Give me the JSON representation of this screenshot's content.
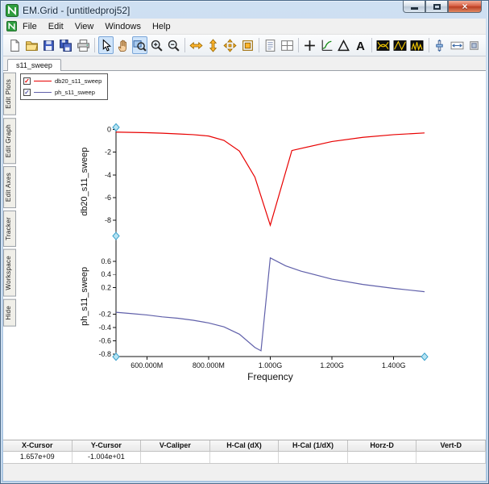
{
  "window": {
    "title": "EM.Grid - [untitledproj52]"
  },
  "menubar": {
    "items": [
      "File",
      "Edit",
      "View",
      "Windows",
      "Help"
    ]
  },
  "toolbar": {
    "groups": [
      [
        {
          "name": "new-file-button",
          "icon": "doc-new"
        },
        {
          "name": "open-button",
          "icon": "folder-open"
        },
        {
          "name": "save-button",
          "icon": "floppy"
        },
        {
          "name": "save-all-button",
          "icon": "floppy-multi"
        },
        {
          "name": "print-button",
          "icon": "printer"
        }
      ],
      [
        {
          "name": "pointer-tool-button",
          "icon": "cursor-arrow",
          "active": true
        },
        {
          "name": "pan-tool-button",
          "icon": "hand-pan"
        },
        {
          "name": "zoom-window-button",
          "icon": "zoom-window",
          "active": true
        },
        {
          "name": "zoom-in-button",
          "icon": "magnifier-plus"
        },
        {
          "name": "zoom-out-button",
          "icon": "magnifier-minus"
        }
      ],
      [
        {
          "name": "fit-horizontal-button",
          "icon": "arrows-horizontal-orange"
        },
        {
          "name": "fit-vertical-button",
          "icon": "arrows-vertical-orange"
        },
        {
          "name": "fit-all-button",
          "icon": "arrows-all-orange"
        },
        {
          "name": "zoom-extents-button",
          "icon": "box-orange"
        }
      ],
      [
        {
          "name": "single-plot-layout-button",
          "icon": "page-lines"
        },
        {
          "name": "grid-plot-layout-button",
          "icon": "page-grid"
        }
      ],
      [
        {
          "name": "add-marker-button",
          "icon": "plus-cross"
        },
        {
          "name": "show-axes-button",
          "icon": "axes-curve"
        },
        {
          "name": "caliper-button",
          "icon": "delta-triangle"
        },
        {
          "name": "add-text-button",
          "icon": "letter-a"
        }
      ],
      [
        {
          "name": "eye-diagram-button",
          "icon": "eye-diagram"
        },
        {
          "name": "cross-trace-button",
          "icon": "eye-cross"
        },
        {
          "name": "spectrum-button",
          "icon": "eye-spectrum"
        }
      ],
      [
        {
          "name": "vertical-scale-button",
          "icon": "slider-vertical"
        },
        {
          "name": "horizontal-span-button",
          "icon": "arrows-box"
        },
        {
          "name": "options-button",
          "icon": "small-box"
        }
      ]
    ]
  },
  "tabs": [
    {
      "label": "s11_sweep",
      "active": true
    }
  ],
  "sidebar": {
    "tabs": [
      "Edit Plots",
      "Edit Graph",
      "Edit Axes",
      "Tracker",
      "Workspace",
      "Hide"
    ]
  },
  "legend": {
    "items": [
      {
        "label": "db20_s11_sweep",
        "color": "#e80000",
        "checked": true
      },
      {
        "label": "ph_s11_sweep",
        "color": "#6060aa",
        "checked": true
      }
    ]
  },
  "colors": {
    "trace_red": "#e80000",
    "trace_blue": "#6060aa",
    "handle_fill": "#b8e4f2",
    "handle_stroke": "#38a0cc"
  },
  "chart_data": [
    {
      "type": "line",
      "ylabel": "db20_s11_sweep",
      "ylim": [
        -9.4,
        0.2
      ],
      "yticks": [
        {
          "v": 0,
          "l": "0"
        },
        {
          "v": -2,
          "l": "-2"
        },
        {
          "v": -4,
          "l": "-4"
        },
        {
          "v": -6,
          "l": "-6"
        },
        {
          "v": -8,
          "l": "-8"
        }
      ],
      "xlim": [
        500000000.0,
        1500000000.0
      ],
      "series": [
        {
          "name": "db20_s11_sweep",
          "color": "#e80000",
          "x": [
            500000000.0,
            550000000.0,
            600000000.0,
            650000000.0,
            700000000.0,
            750000000.0,
            800000000.0,
            850000000.0,
            900000000.0,
            950000000.0,
            1000000000.0,
            1070000000.0,
            1200000000.0,
            1300000000.0,
            1400000000.0,
            1500000000.0
          ],
          "y": [
            -0.22,
            -0.25,
            -0.28,
            -0.32,
            -0.38,
            -0.45,
            -0.57,
            -0.95,
            -1.9,
            -4.2,
            -8.45,
            -1.85,
            -1.05,
            -0.68,
            -0.45,
            -0.3
          ]
        }
      ]
    },
    {
      "type": "line",
      "ylabel": "ph_s11_sweep",
      "xlabel": "Frequency",
      "ylim": [
        -0.84,
        0.98
      ],
      "yticks": [
        {
          "v": 0.6,
          "l": "0.6"
        },
        {
          "v": 0.4,
          "l": "0.4"
        },
        {
          "v": 0.2,
          "l": "0.2"
        },
        {
          "v": -0.2,
          "l": "-0.2"
        },
        {
          "v": -0.4,
          "l": "-0.4"
        },
        {
          "v": -0.6,
          "l": "-0.6"
        },
        {
          "v": -0.8,
          "l": "-0.8"
        }
      ],
      "xlim": [
        500000000.0,
        1500000000.0
      ],
      "xticks": [
        {
          "v": 600000000.0,
          "l": "600.000M"
        },
        {
          "v": 800000000.0,
          "l": "800.000M"
        },
        {
          "v": 1000000000.0,
          "l": "1.000G"
        },
        {
          "v": 1200000000.0,
          "l": "1.200G"
        },
        {
          "v": 1400000000.0,
          "l": "1.400G"
        }
      ],
      "series": [
        {
          "name": "ph_s11_sweep",
          "color": "#6060aa",
          "x": [
            500000000.0,
            550000000.0,
            600000000.0,
            650000000.0,
            700000000.0,
            750000000.0,
            800000000.0,
            850000000.0,
            900000000.0,
            950000000.0,
            970000000.0,
            1000000000.0,
            1050000000.0,
            1100000000.0,
            1200000000.0,
            1300000000.0,
            1400000000.0,
            1500000000.0
          ],
          "y": [
            -0.17,
            -0.19,
            -0.21,
            -0.24,
            -0.26,
            -0.29,
            -0.33,
            -0.39,
            -0.5,
            -0.7,
            -0.75,
            0.65,
            0.53,
            0.45,
            0.33,
            0.25,
            0.19,
            0.14
          ]
        }
      ]
    }
  ],
  "cursor_table": {
    "headers": [
      "X-Cursor",
      "Y-Cursor",
      "V-Caliper",
      "H-Cal (dX)",
      "H-Cal (1/dX)",
      "Horz-D",
      "Vert-D"
    ],
    "values": [
      "1.657e+09",
      "-1.004e+01",
      "",
      "",
      "",
      "",
      ""
    ]
  }
}
